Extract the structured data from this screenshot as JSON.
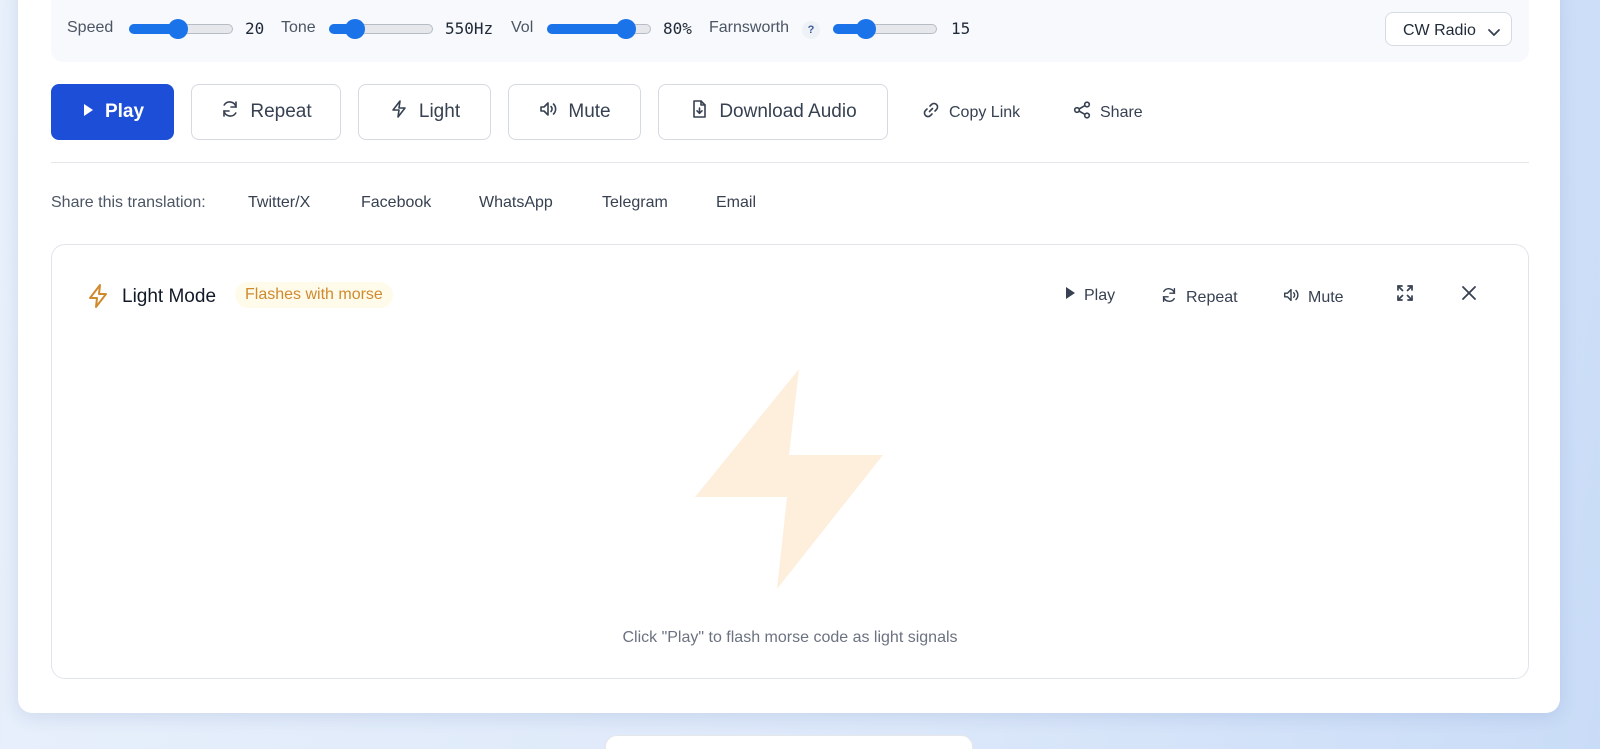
{
  "controls": {
    "speed": {
      "label": "Speed",
      "value": "20",
      "level": 0.47
    },
    "tone": {
      "label": "Tone",
      "value": "550Hz",
      "level": 0.25
    },
    "vol": {
      "label": "Vol",
      "value": "80%",
      "level": 0.76
    },
    "farnsworth": {
      "label": "Farnsworth",
      "help": "?",
      "value": "15",
      "level": 0.32
    },
    "preset": {
      "selected": "CW Radio"
    }
  },
  "actions": {
    "play": "Play",
    "repeat": "Repeat",
    "light": "Light",
    "mute": "Mute",
    "download": "Download Audio",
    "copy_link": "Copy Link",
    "share": "Share"
  },
  "share_row": {
    "label": "Share this translation:",
    "targets": [
      "Twitter/X",
      "Facebook",
      "WhatsApp",
      "Telegram",
      "Email"
    ]
  },
  "light_panel": {
    "title": "Light Mode",
    "badge": "Flashes with morse",
    "play": "Play",
    "repeat": "Repeat",
    "mute": "Mute",
    "hint": "Click \"Play\" to flash morse code as light signals"
  },
  "colors": {
    "accent": "#1d4ed8",
    "slider": "#1a73e8",
    "light_icon": "#d08a2e",
    "bolt_placeholder": "#fdefdc"
  }
}
